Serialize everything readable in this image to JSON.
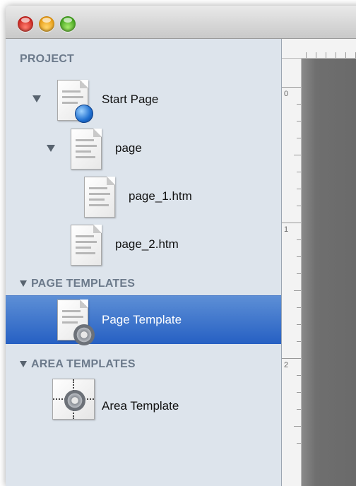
{
  "sidebar": {
    "project_header": "PROJECT",
    "page_templates_header": "PAGE TEMPLATES",
    "area_templates_header": "AREA TEMPLATES",
    "items": [
      {
        "label": "Start Page"
      },
      {
        "label": "page"
      },
      {
        "label": "page_1.htm"
      },
      {
        "label": "page_2.htm"
      },
      {
        "label": "Page Template"
      },
      {
        "label": "Area Template"
      }
    ]
  },
  "ruler": {
    "vertical_marks": [
      "0",
      "1",
      "2"
    ]
  },
  "colors": {
    "selection": "#2f6bc9",
    "sidebar_bg": "#dde4ec",
    "header_text": "#6c7a8b"
  }
}
